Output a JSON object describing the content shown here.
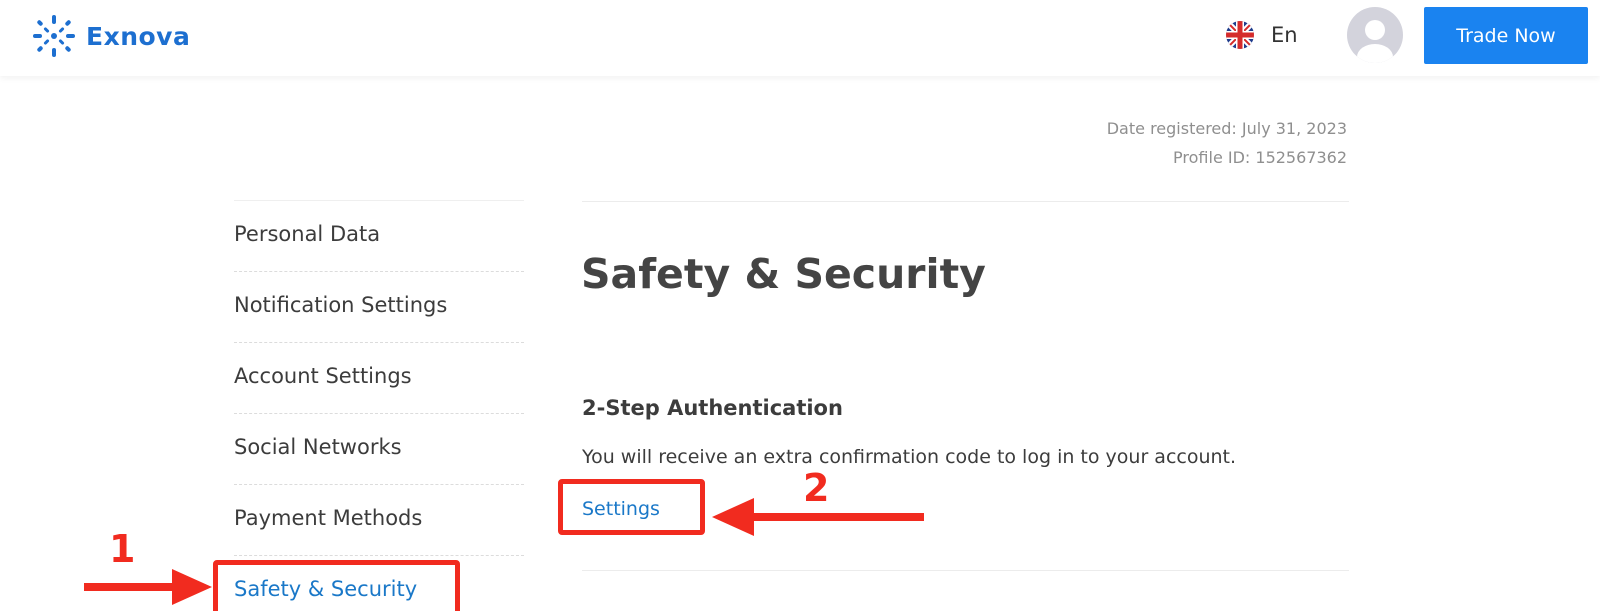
{
  "header": {
    "brand": "Exnova",
    "language": "En",
    "trade_button": "Trade Now"
  },
  "profile": {
    "date_registered": "Date registered: July 31, 2023",
    "profile_id": "Profile ID: 152567362"
  },
  "sidebar": {
    "items": [
      {
        "label": "Personal Data"
      },
      {
        "label": "Notification Settings"
      },
      {
        "label": "Account Settings"
      },
      {
        "label": "Social Networks"
      },
      {
        "label": "Payment Methods"
      },
      {
        "label": "Safety & Security"
      }
    ]
  },
  "main": {
    "title": "Safety & Security",
    "section": {
      "title": "2-Step Authentication",
      "description": "You will receive an extra confirmation code to log in to your account.",
      "link": "Settings"
    }
  },
  "annotations": {
    "step1": "1",
    "step2": "2"
  },
  "colors": {
    "brand": "#1d6fd0",
    "accent": "#1a83f0",
    "link": "#1a78c8",
    "annotation": "#f12b1f"
  }
}
